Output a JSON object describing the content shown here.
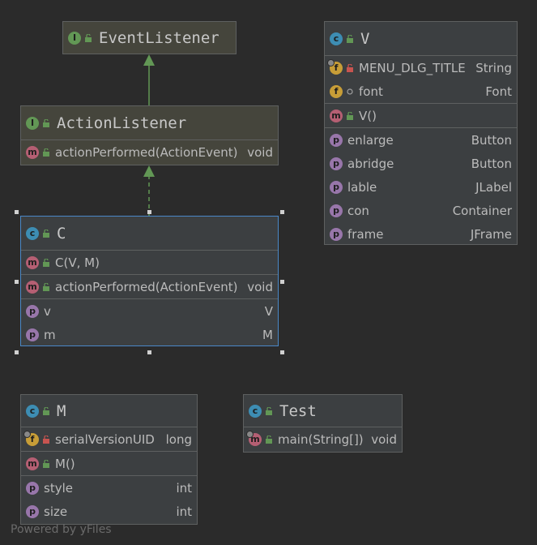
{
  "nodes": {
    "event_listener": {
      "kind": "I",
      "title": "EventListener"
    },
    "action_listener": {
      "kind": "I",
      "title": "ActionListener",
      "methods": [
        {
          "name": "actionPerformed(ActionEvent)",
          "type": "void"
        }
      ]
    },
    "c": {
      "kind": "C",
      "title": "C",
      "constructors": [
        {
          "name": "C(V, M)"
        }
      ],
      "methods": [
        {
          "name": "actionPerformed(ActionEvent)",
          "type": "void"
        }
      ],
      "properties": [
        {
          "name": "v",
          "type": "V"
        },
        {
          "name": "m",
          "type": "M"
        }
      ]
    },
    "v": {
      "kind": "C",
      "title": "V",
      "fields": [
        {
          "name": "MENU_DLG_TITLE",
          "type": "String"
        },
        {
          "name": "font",
          "type": "Font"
        }
      ],
      "constructors": [
        {
          "name": "V()"
        }
      ],
      "properties": [
        {
          "name": "enlarge",
          "type": "Button"
        },
        {
          "name": "abridge",
          "type": "Button"
        },
        {
          "name": "lable",
          "type": "JLabel"
        },
        {
          "name": "con",
          "type": "Container"
        },
        {
          "name": "frame",
          "type": "JFrame"
        }
      ]
    },
    "m": {
      "kind": "C",
      "title": "M",
      "fields": [
        {
          "name": "serialVersionUID",
          "type": "long"
        }
      ],
      "constructors": [
        {
          "name": "M()"
        }
      ],
      "properties": [
        {
          "name": "style",
          "type": "int"
        },
        {
          "name": "size",
          "type": "int"
        }
      ]
    },
    "test": {
      "kind": "C",
      "title": "Test",
      "methods": [
        {
          "name": "main(String[])",
          "type": "void"
        }
      ]
    }
  },
  "footer": "Powered by yFiles",
  "colors": {
    "background": "#2b2b2b",
    "node": "#3c3f41",
    "interface_node": "#45453c",
    "selection": "#4a88c7",
    "edge": "#629755"
  }
}
